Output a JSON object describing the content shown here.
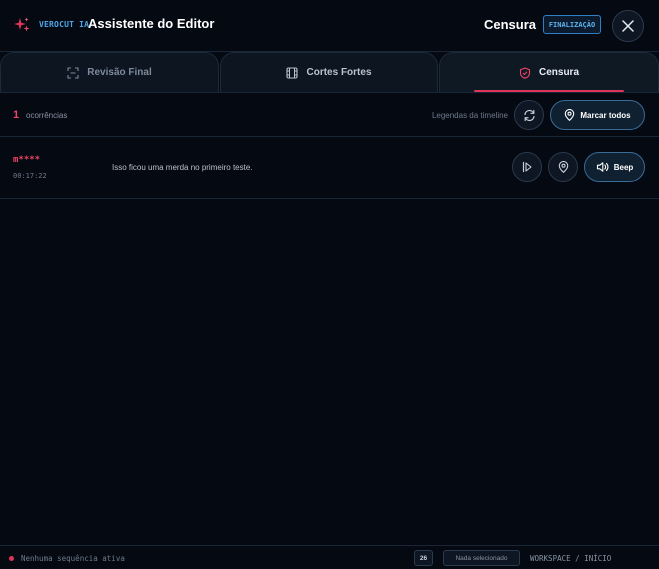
{
  "header": {
    "brand": "VEROCUT IA",
    "title": "Assistente do Editor",
    "mode_title": "Censura",
    "mode_badge": "FINALIZAÇÃO"
  },
  "tabs": [
    {
      "label": "Revisão Final",
      "icon": "scan-icon"
    },
    {
      "label": "Cortes Fortes",
      "icon": "film-icon"
    },
    {
      "label": "Censura",
      "icon": "shield-icon",
      "active": true
    }
  ],
  "toolbar": {
    "count": "1",
    "count_label": "ocorrências",
    "timeline_label": "Legendas da timeline",
    "mark_all_label": "Marcar todos"
  },
  "occurrences": [
    {
      "word": "m****",
      "time": "00:17:22",
      "sentence": "Isso ficou uma merda no primeiro teste.",
      "action_label": "Beep"
    }
  ],
  "status": {
    "text": "Nenhuma sequência ativa",
    "count": "26",
    "selection": "Nada selecionado",
    "breadcrumb": "WORKSPACE / INÍCIO"
  },
  "colors": {
    "background": "#050a12",
    "accent_red": "#ef4466",
    "accent_blue": "#4aa8e8"
  }
}
